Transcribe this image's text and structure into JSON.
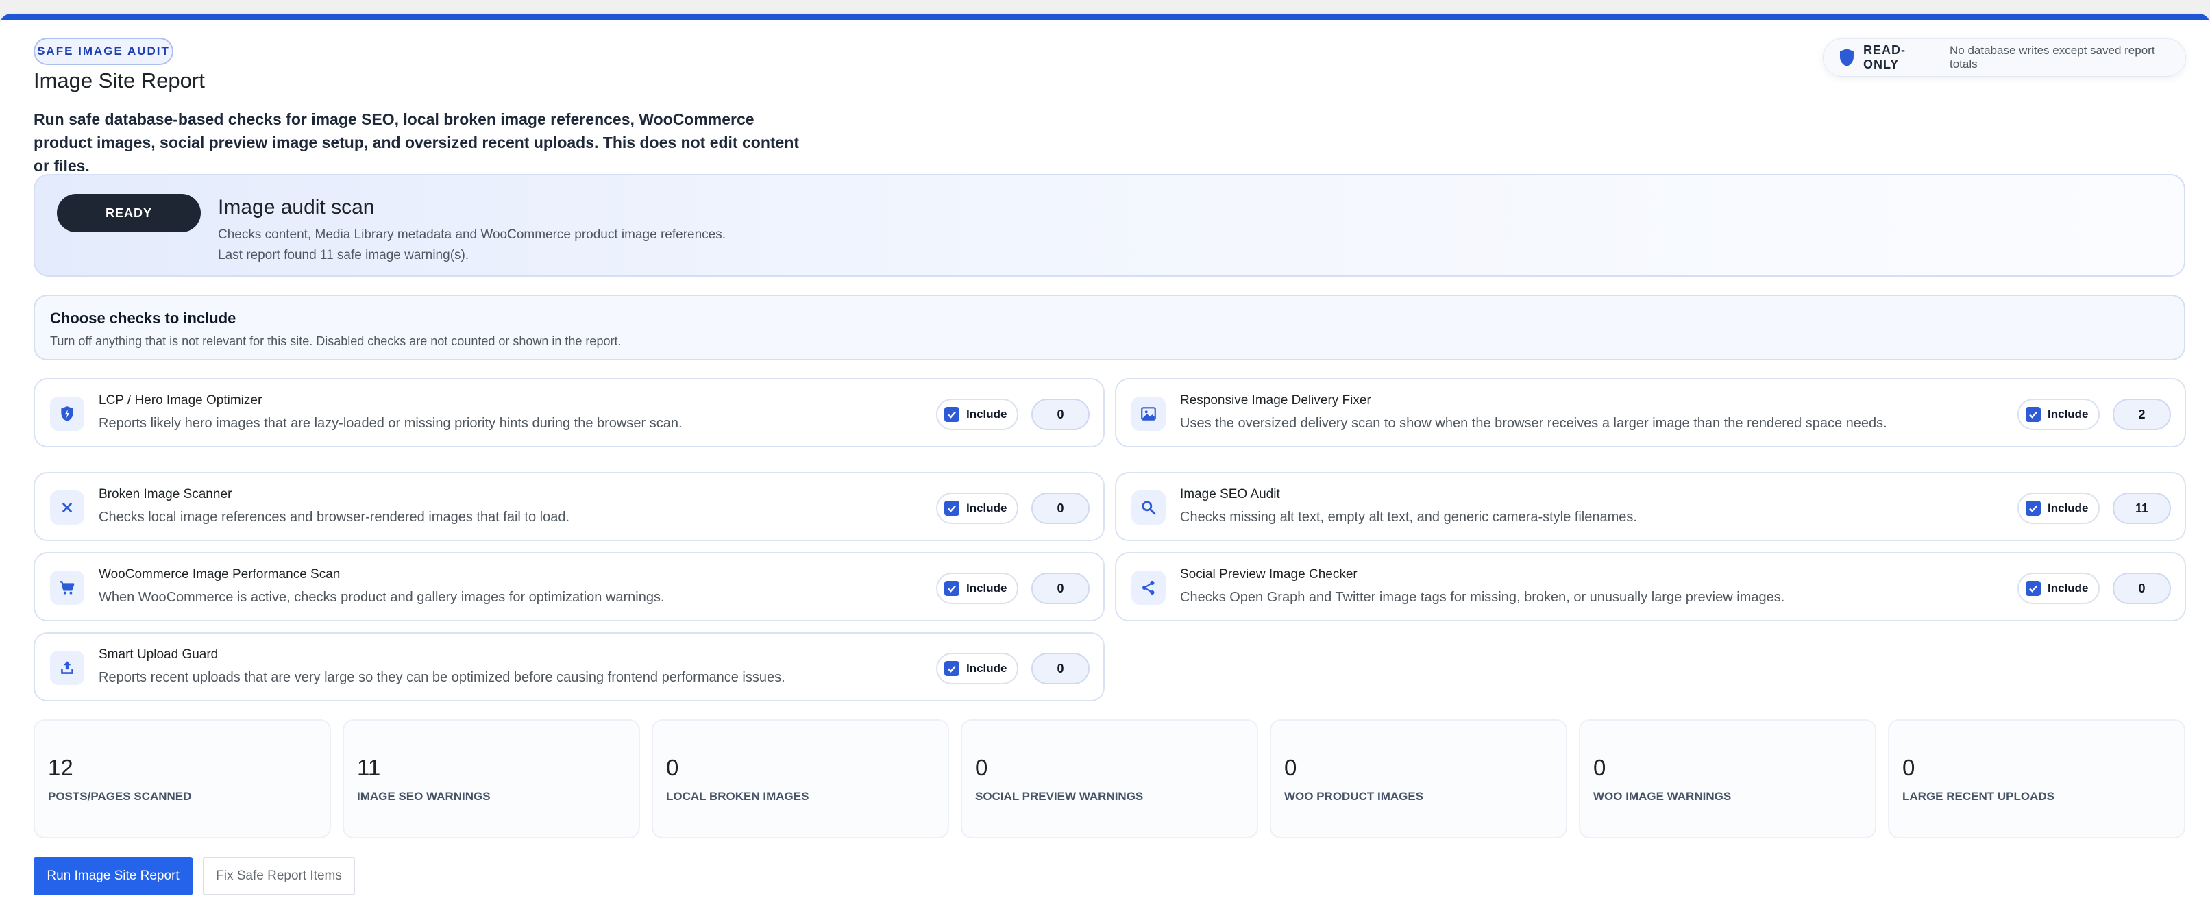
{
  "header": {
    "tag": "SAFE IMAGE AUDIT",
    "title": "Image Site Report",
    "description": "Run safe database-based checks for image SEO, local broken image references, WooCommerce product images, social preview image setup, and oversized recent uploads. This does not edit content or files.",
    "readonly_label": "READ-ONLY",
    "readonly_text": "No database writes except saved report totals"
  },
  "scan": {
    "status": "READY",
    "title": "Image audit scan",
    "line1": "Checks content, Media Library metadata and WooCommerce product image references.",
    "line2": "Last report found 11 safe image warning(s)."
  },
  "choose": {
    "title": "Choose checks to include",
    "subtitle": "Turn off anything that is not relevant for this site. Disabled checks are not counted or shown in the report."
  },
  "include_label": "Include",
  "checks": [
    {
      "title": "LCP / Hero Image Optimizer",
      "desc": "Reports likely hero images that are lazy-loaded or missing priority hints during the browser scan.",
      "count": "0",
      "icon": "shield-bolt-icon",
      "included": true
    },
    {
      "title": "Responsive Image Delivery Fixer",
      "desc": "Uses the oversized delivery scan to show when the browser receives a larger image than the rendered space needs.",
      "count": "2",
      "icon": "image-icon",
      "included": true
    },
    {
      "title": "Broken Image Scanner",
      "desc": "Checks local image references and browser-rendered images that fail to load.",
      "count": "0",
      "icon": "close-icon",
      "included": true
    },
    {
      "title": "Image SEO Audit",
      "desc": "Checks missing alt text, empty alt text, and generic camera-style filenames.",
      "count": "11",
      "icon": "search-icon",
      "included": true
    },
    {
      "title": "WooCommerce Image Performance Scan",
      "desc": "When WooCommerce is active, checks product and gallery images for optimization warnings.",
      "count": "0",
      "icon": "cart-icon",
      "included": true
    },
    {
      "title": "Social Preview Image Checker",
      "desc": "Checks Open Graph and Twitter image tags for missing, broken, or unusually large preview images.",
      "count": "0",
      "icon": "share-icon",
      "included": true
    },
    {
      "title": "Smart Upload Guard",
      "desc": "Reports recent uploads that are very large so they can be optimized before causing frontend performance issues.",
      "count": "0",
      "icon": "upload-icon",
      "included": true
    }
  ],
  "stats": [
    {
      "value": "12",
      "label": "POSTS/PAGES SCANNED"
    },
    {
      "value": "11",
      "label": "IMAGE SEO WARNINGS"
    },
    {
      "value": "0",
      "label": "LOCAL BROKEN IMAGES"
    },
    {
      "value": "0",
      "label": "SOCIAL PREVIEW WARNINGS"
    },
    {
      "value": "0",
      "label": "WOO PRODUCT IMAGES"
    },
    {
      "value": "0",
      "label": "WOO IMAGE WARNINGS"
    },
    {
      "value": "0",
      "label": "LARGE RECENT UPLOADS"
    }
  ],
  "actions": {
    "run": "Run Image Site Report",
    "fix": "Fix Safe Report Items"
  },
  "colors": {
    "accent": "#2563eb",
    "topbar": "#2056d6",
    "ready": "#1e2633",
    "icon": "#2d5bd7"
  }
}
